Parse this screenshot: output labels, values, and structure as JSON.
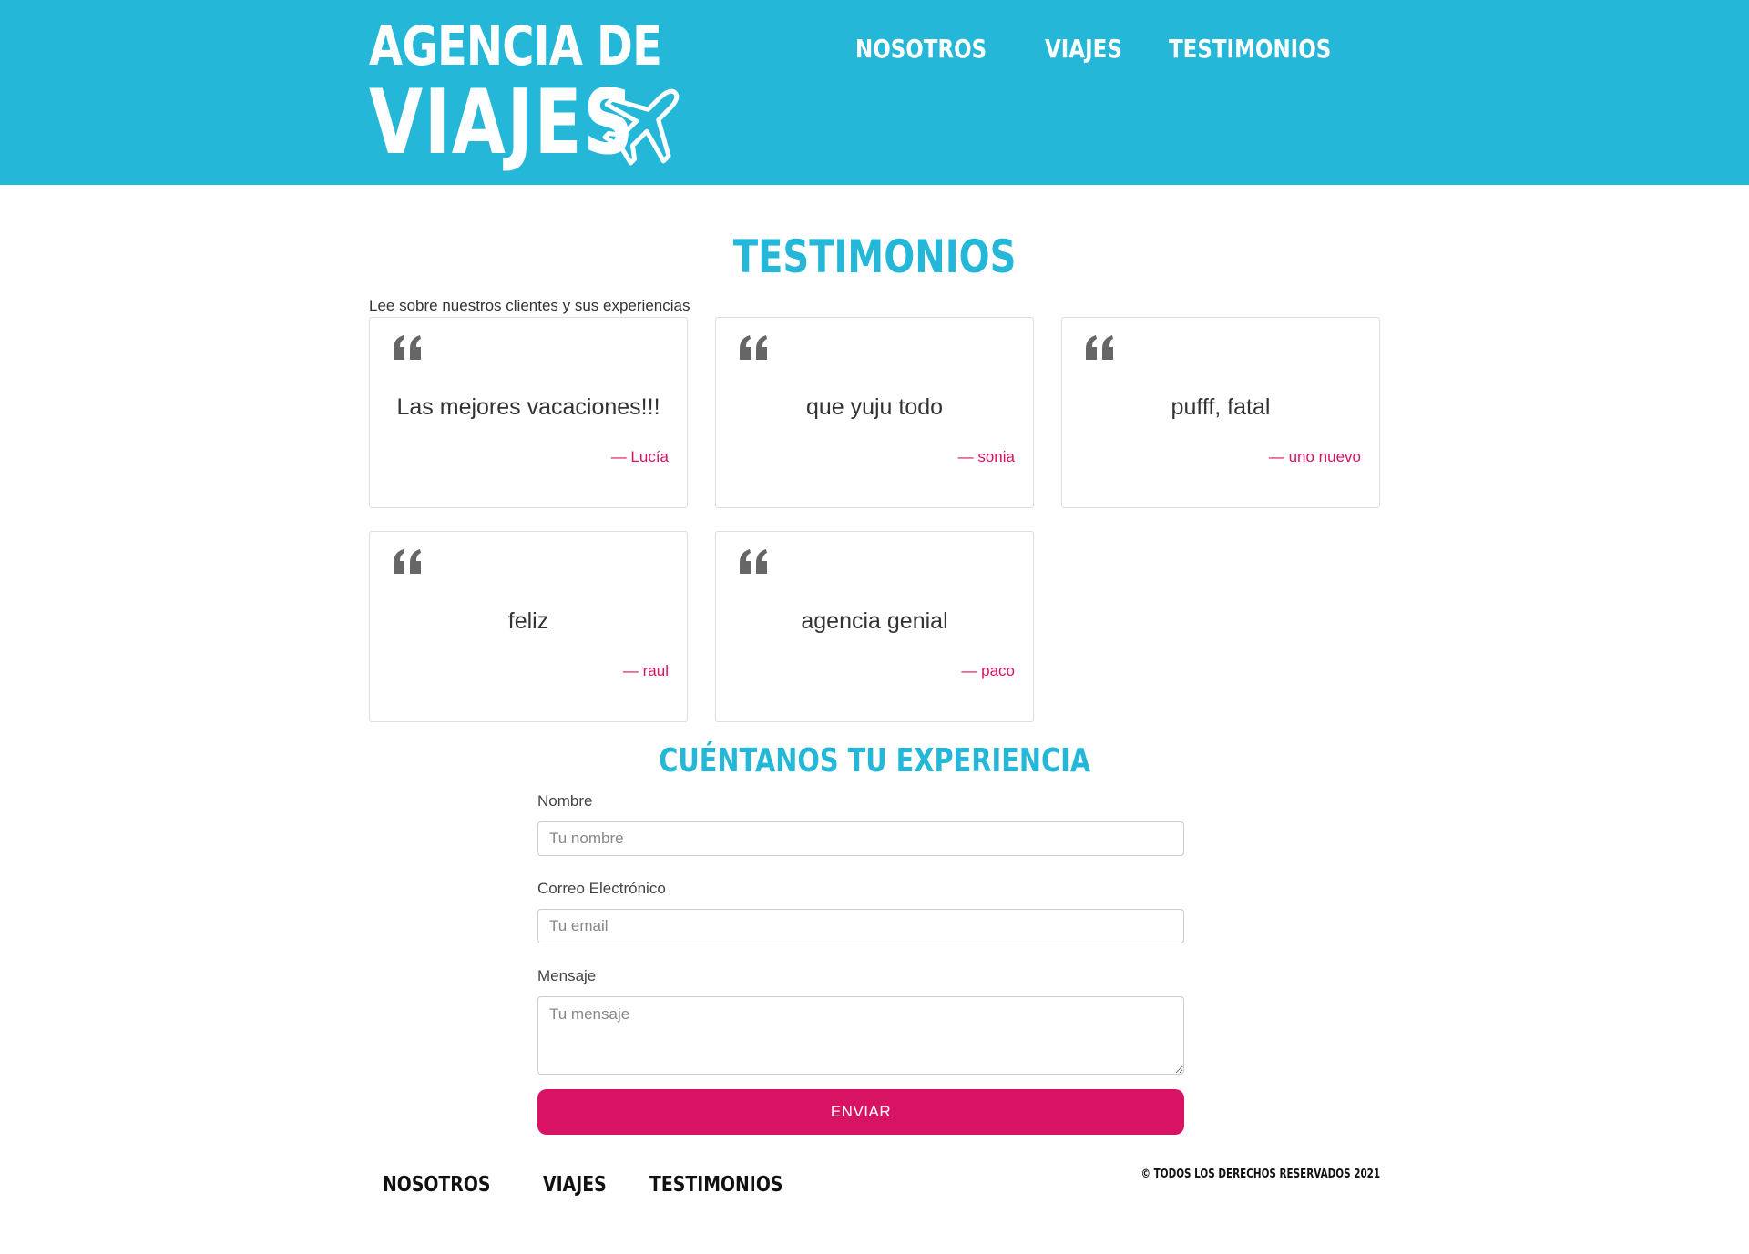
{
  "header": {
    "logo_line1": "AGENCIA DE",
    "logo_line2": "VIAJES",
    "plane_icon": "airplane-icon",
    "background_color": "#24b7d8",
    "nav": [
      {
        "label": "NOSOTROS"
      },
      {
        "label": "VIAJES"
      },
      {
        "label": "TESTIMONIOS"
      }
    ]
  },
  "main": {
    "title": "TESTIMONIOS",
    "intro": "Lee sobre nuestros clientes y sus experiencias",
    "quote_icon": "quote-icon",
    "testimonials": [
      {
        "text": "Las mejores vacaciones!!!",
        "author": "— Lucía"
      },
      {
        "text": "que yuju todo",
        "author": "— sonia"
      },
      {
        "text": "pufff, fatal",
        "author": "— uno nuevo"
      },
      {
        "text": "feliz",
        "author": "— raul"
      },
      {
        "text": "agencia genial",
        "author": "— paco"
      }
    ]
  },
  "form": {
    "title": "CUÉNTANOS TU EXPERIENCIA",
    "name_label": "Nombre",
    "name_placeholder": "Tu nombre",
    "email_label": "Correo Electrónico",
    "email_placeholder": "Tu email",
    "message_label": "Mensaje",
    "message_placeholder": "Tu mensaje",
    "submit_label": "ENVIAR",
    "submit_color": "#d91363"
  },
  "footer": {
    "nav": [
      {
        "label": "NOSOTROS"
      },
      {
        "label": "VIAJES"
      },
      {
        "label": "TESTIMONIOS"
      }
    ],
    "copyright": "© TODOS LOS DERECHOS RESERVADOS 2021"
  }
}
